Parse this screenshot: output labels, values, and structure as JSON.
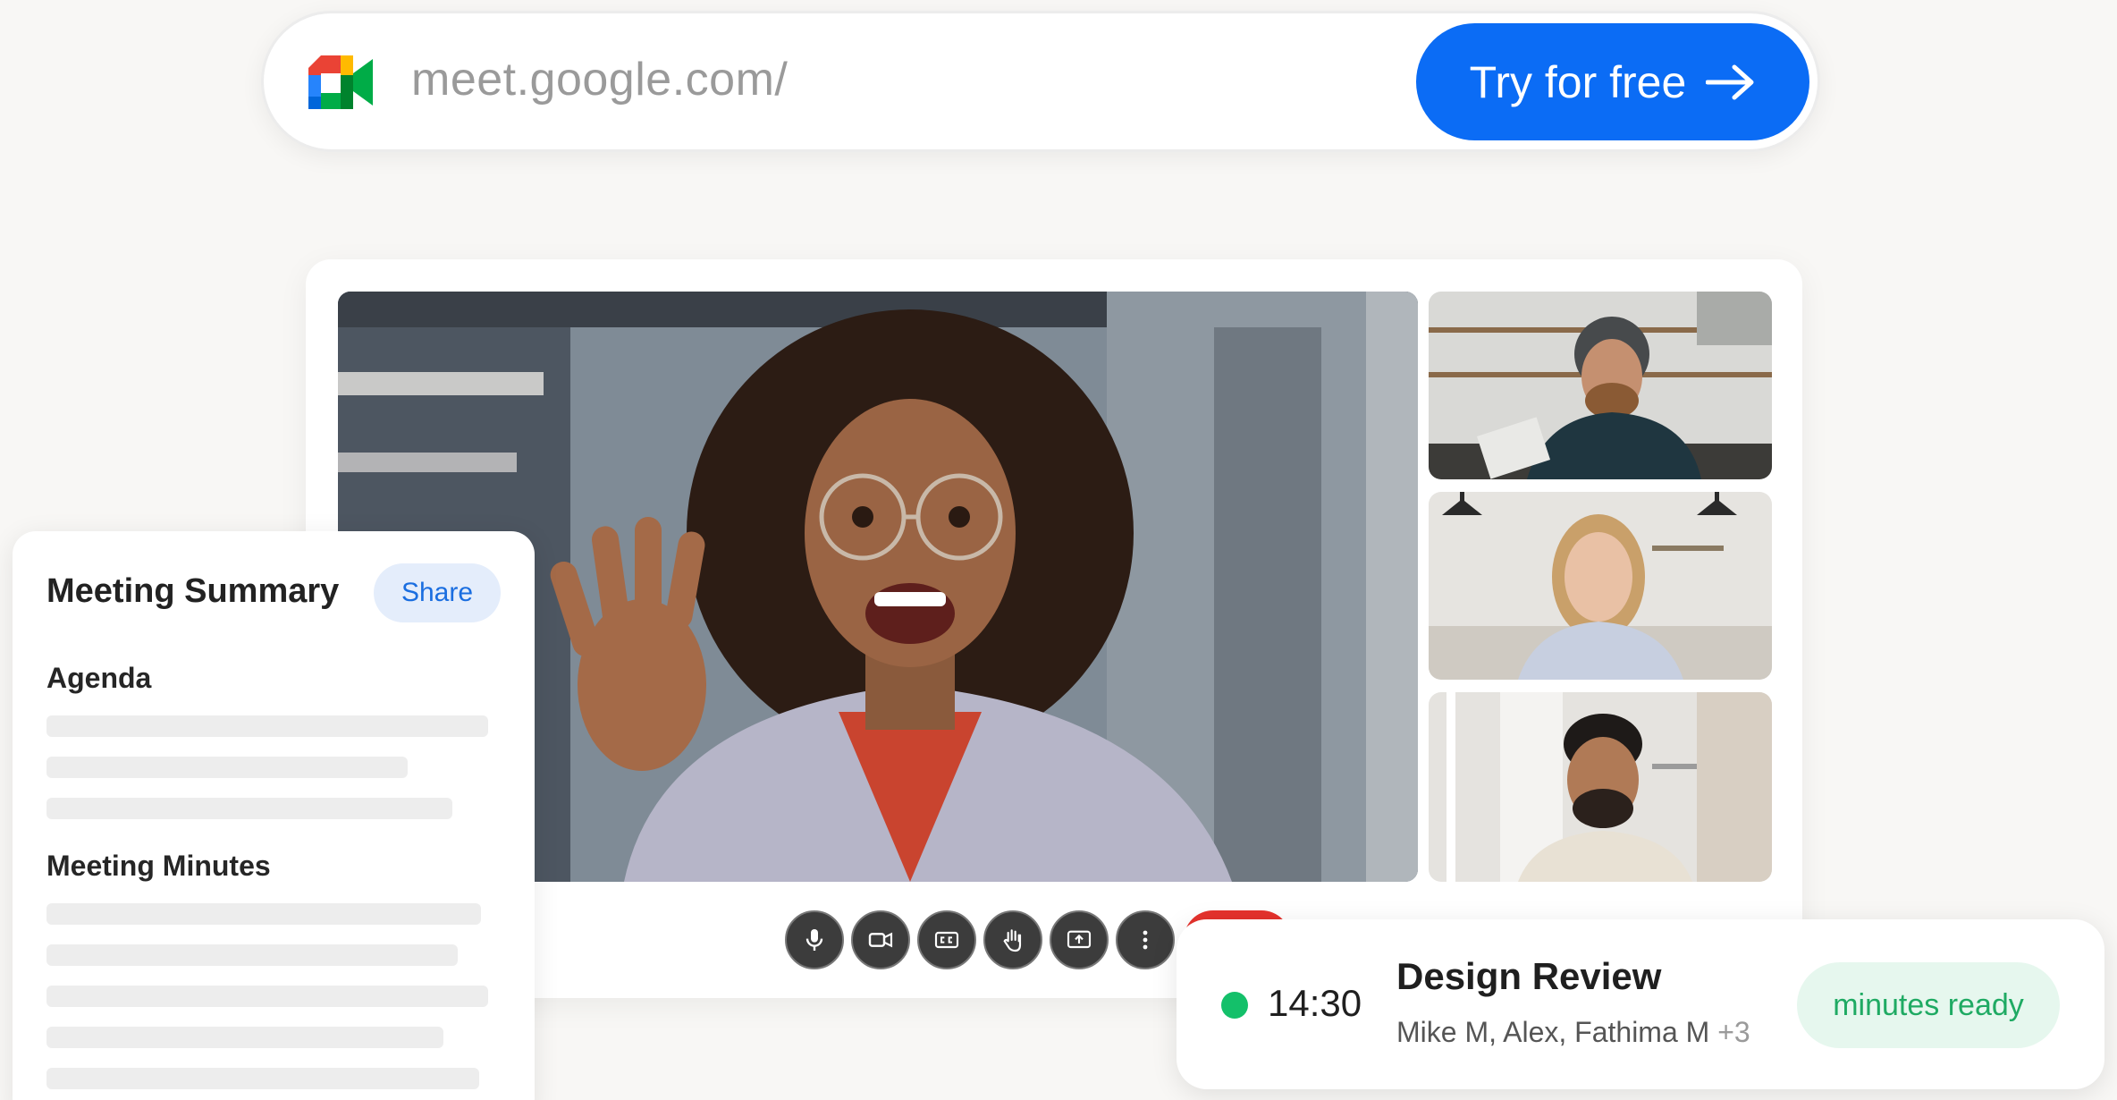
{
  "url_bar": {
    "url": "meet.google.com/",
    "cta_label": "Try for free"
  },
  "summary": {
    "title": "Meeting Summary",
    "share_label": "Share",
    "agenda_heading": "Agenda",
    "minutes_heading": "Meeting Minutes"
  },
  "notification": {
    "time": "14:30",
    "title": "Design Review",
    "participants": "Mike M, Alex, Fathima M",
    "extra_count": "+3",
    "badge": "minutes ready"
  },
  "colors": {
    "accent": "#0b6cf5",
    "status_green": "#14c06a",
    "end_call": "#e5322d"
  },
  "icons": [
    "google-meet-logo",
    "arrow-right-icon",
    "mic-icon",
    "camera-icon",
    "captions-icon",
    "raise-hand-icon",
    "present-icon",
    "more-vertical-icon"
  ]
}
